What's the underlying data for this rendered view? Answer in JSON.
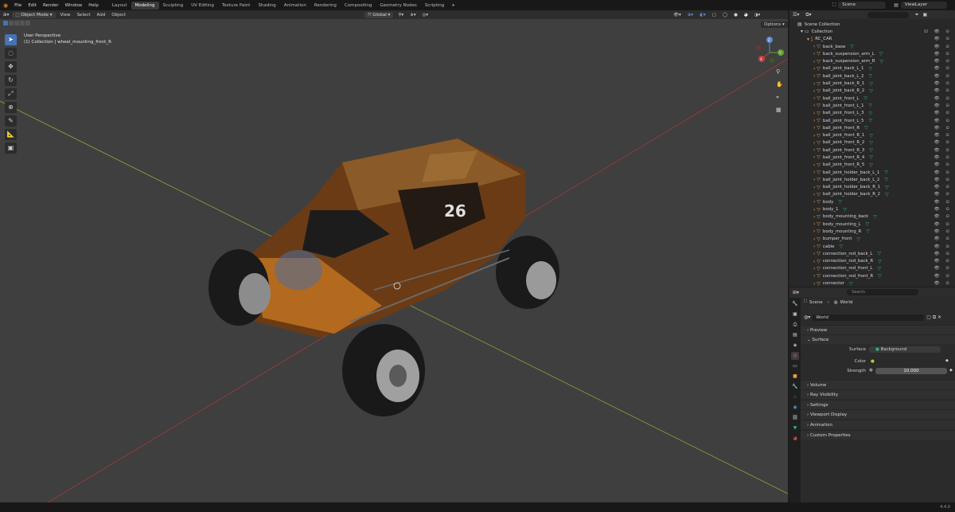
{
  "menu": [
    "File",
    "Edit",
    "Render",
    "Window",
    "Help"
  ],
  "workspaces": [
    {
      "label": "Layout",
      "active": false
    },
    {
      "label": "Modeling",
      "active": true
    },
    {
      "label": "Sculpting",
      "active": false
    },
    {
      "label": "UV Editing",
      "active": false
    },
    {
      "label": "Texture Paint",
      "active": false
    },
    {
      "label": "Shading",
      "active": false
    },
    {
      "label": "Animation",
      "active": false
    },
    {
      "label": "Rendering",
      "active": false
    },
    {
      "label": "Compositing",
      "active": false
    },
    {
      "label": "Geometry Nodes",
      "active": false
    },
    {
      "label": "Scripting",
      "active": false
    }
  ],
  "scene": "Scene",
  "view_layer": "ViewLayer",
  "viewport": {
    "mode": "Object Mode",
    "header_menu": [
      "View",
      "Select",
      "Add",
      "Object"
    ],
    "orientation": "Global",
    "options_label": "Options",
    "perspective": "User Perspective",
    "context": "(1) Collection | wheel_mounting_front_R",
    "gizmo_axes": [
      "X",
      "Y",
      "Z"
    ],
    "number_badge": "26"
  },
  "outliner": {
    "search_placeholder": "",
    "scene_collection": "Scene Collection",
    "collection": "Collection",
    "group": "RC_CAR",
    "items": [
      "back_base",
      "back_suspension_arm_L",
      "back_suspension_arm_R",
      "ball_joint_back_L_1",
      "ball_joint_back_L_2",
      "ball_joint_back_R_1",
      "ball_joint_back_R_2",
      "ball_joint_front_L",
      "ball_joint_front_L_1",
      "ball_joint_front_L_3",
      "ball_joint_front_L_5",
      "ball_joint_front_R",
      "ball_joint_front_R_1",
      "ball_joint_front_R_2",
      "ball_joint_front_R_3",
      "ball_joint_front_R_4",
      "ball_joint_front_R_5",
      "ball_joint_holder_back_L_1",
      "ball_joint_holder_back_L_2",
      "ball_joint_holder_back_R_1",
      "ball_joint_holder_back_R_2",
      "body",
      "body_1",
      "body_mounting_back",
      "body_mounting_L",
      "body_mounting_R",
      "bumper_front",
      "cable",
      "connection_rod_back_L",
      "connection_rod_back_R",
      "connection_rod_front_L",
      "connection_rod_front_R",
      "connector"
    ]
  },
  "properties": {
    "search_placeholder": "Search",
    "breadcrumb_scene": "Scene",
    "breadcrumb_world": "World",
    "world_name": "World",
    "sections_top": [
      "Preview"
    ],
    "surface_label": "Surface",
    "surface_field": "Surface",
    "surface_value": "Background",
    "color_label": "Color",
    "strength_label": "Strength",
    "strength_value": "10.000",
    "sections_bottom": [
      "Volume",
      "Ray Visibility",
      "Settings",
      "Viewport Display",
      "Animation",
      "Custom Properties"
    ]
  },
  "status": {
    "version": "4.4.0"
  },
  "colors": {
    "accent": "#4772b3",
    "viewport_bg": "#3f3f3f",
    "object_icon": "#e89c48",
    "mesh_icon": "#2fae8c"
  }
}
